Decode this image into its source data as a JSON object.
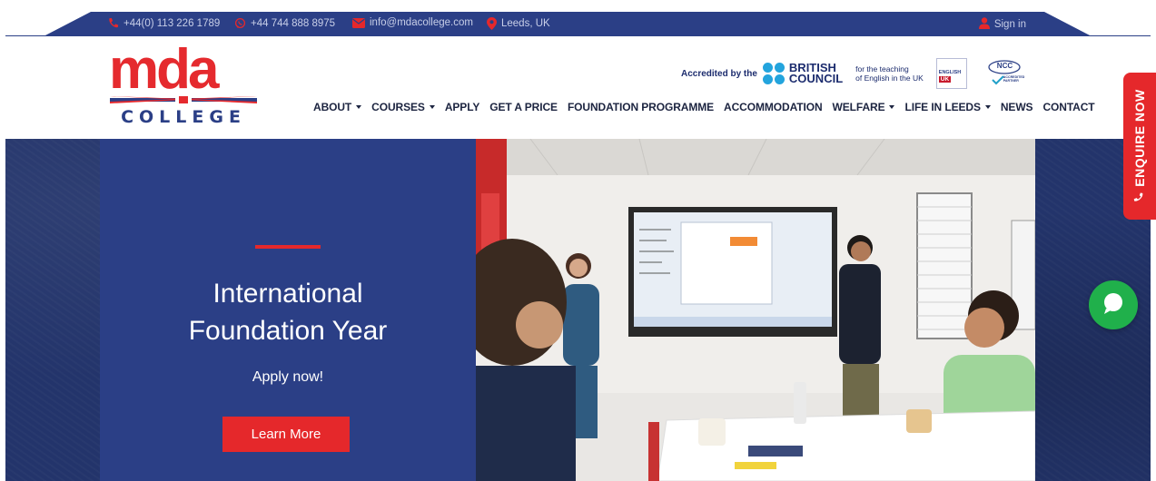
{
  "topbar": {
    "phone1": "+44(0) 113 226 1789",
    "phone2": "+44 744 888 8975",
    "email": "info@mdacollege.com",
    "location": "Leeds, UK",
    "signin": "Sign in",
    "icons": [
      "phone-icon",
      "whatsapp-icon",
      "envelope-icon",
      "map-pin-icon",
      "user-icon"
    ]
  },
  "logo": {
    "word": "mda",
    "sub": "COLLEGE"
  },
  "accreditation": {
    "lead": "Accredited by the",
    "bc_line1": "BRITISH",
    "bc_line2": "COUNCIL",
    "bc_tag_line1": "for the teaching",
    "bc_tag_line2": "of English in the UK",
    "eng_uk_top": "ENGLISH",
    "eng_uk_bottom": "UK",
    "ncc": "NCC",
    "ncc_sub": "ACCREDITED PARTNER"
  },
  "nav": {
    "items": [
      {
        "label": "ABOUT",
        "dropdown": true
      },
      {
        "label": "COURSES",
        "dropdown": true
      },
      {
        "label": "APPLY",
        "dropdown": false
      },
      {
        "label": "GET A PRICE",
        "dropdown": false
      },
      {
        "label": "FOUNDATION PROGRAMME",
        "dropdown": false
      },
      {
        "label": "ACCOMMODATION",
        "dropdown": false
      },
      {
        "label": "WELFARE",
        "dropdown": true
      },
      {
        "label": "LIFE IN LEEDS",
        "dropdown": true
      },
      {
        "label": "NEWS",
        "dropdown": false
      },
      {
        "label": "CONTACT",
        "dropdown": false
      }
    ]
  },
  "hero": {
    "title_line1": "International",
    "title_line2": "Foundation Year",
    "subtitle": "Apply now!",
    "button": "Learn More"
  },
  "floating": {
    "enquire": "ENQUIRE NOW"
  },
  "colors": {
    "navy": "#2b3f86",
    "red": "#e5282b",
    "green": "#20b04b"
  }
}
